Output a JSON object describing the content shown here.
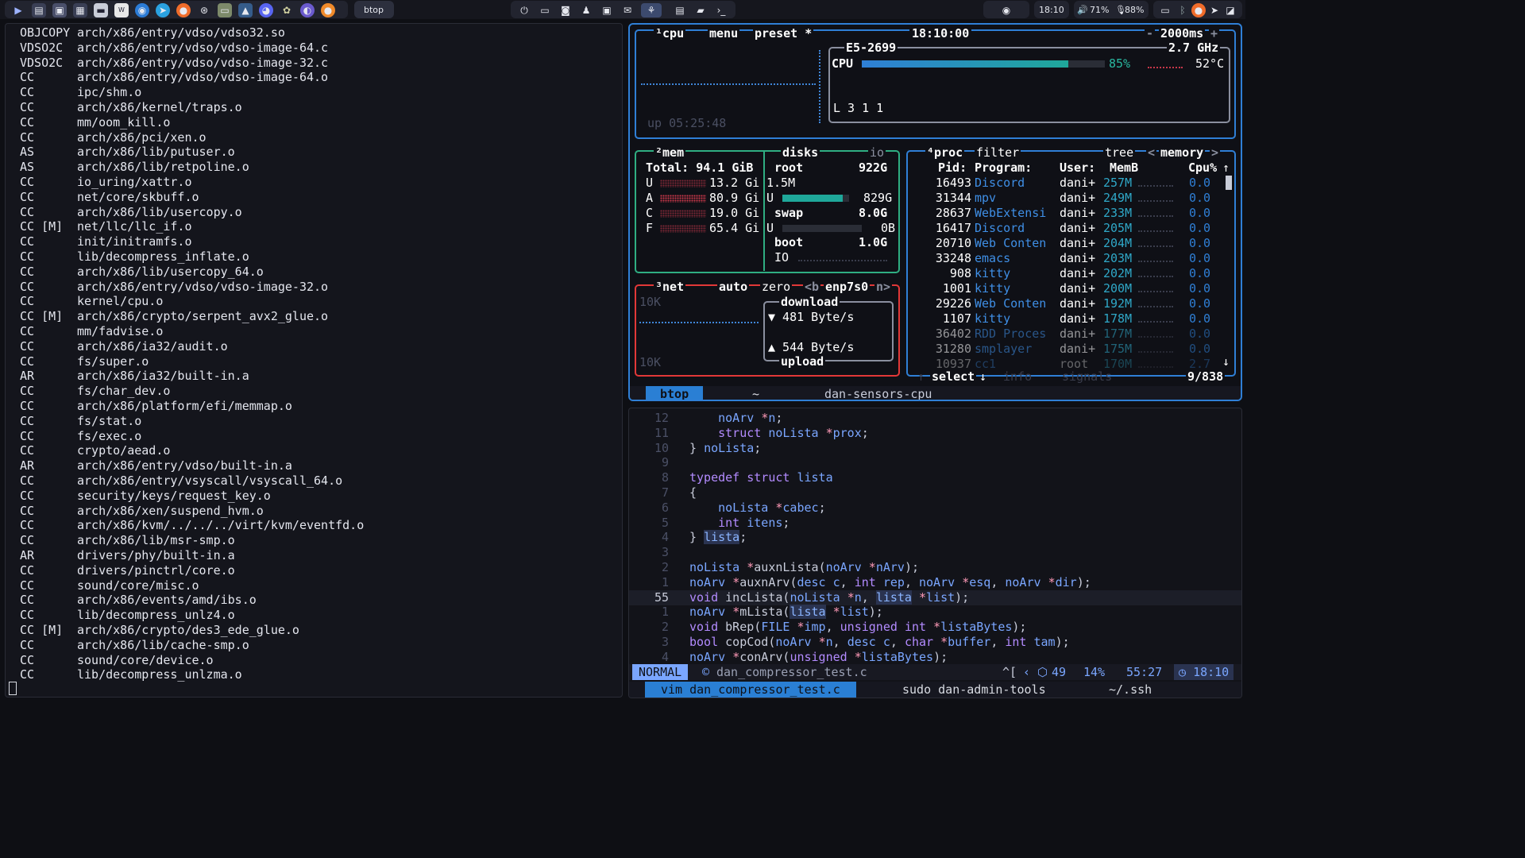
{
  "topbar": {
    "left_icons": [
      "launcher-icon",
      "folder-icon",
      "terminal-icon",
      "image-icon",
      "files-icon",
      "notes-icon",
      "browser-icon",
      "telegram-icon",
      "firefox-icon",
      "steam-icon",
      "archive-icon",
      "monitor-icon",
      "discord-icon",
      "game-icon",
      "apps-icon",
      "orange-icon"
    ],
    "active_window": "btop",
    "workspaces_icons": [
      "power-icon",
      "folder-icon",
      "discord-icon",
      "user-icon",
      "image-icon",
      "mail-icon",
      "code-icon",
      "grid-icon",
      "note-icon",
      "prompt-icon"
    ],
    "clock": "18:10",
    "volume": "71%",
    "mic": "88%",
    "tray_icons": [
      "eye-icon",
      "display-icon",
      "bluetooth-icon",
      "firefox-icon",
      "telegram-icon",
      "window-icon"
    ]
  },
  "build_log": [
    {
      "cmd": "OBJCOPY",
      "path": "arch/x86/entry/vdso/vdso32.so"
    },
    {
      "cmd": "VDSO2C",
      "path": "arch/x86/entry/vdso/vdso-image-64.c"
    },
    {
      "cmd": "VDSO2C",
      "path": "arch/x86/entry/vdso/vdso-image-32.c"
    },
    {
      "cmd": "CC",
      "path": "arch/x86/entry/vdso/vdso-image-64.o"
    },
    {
      "cmd": "CC",
      "path": "ipc/shm.o"
    },
    {
      "cmd": "CC",
      "path": "arch/x86/kernel/traps.o"
    },
    {
      "cmd": "CC",
      "path": "mm/oom_kill.o"
    },
    {
      "cmd": "CC",
      "path": "arch/x86/pci/xen.o"
    },
    {
      "cmd": "AS",
      "path": "arch/x86/lib/putuser.o"
    },
    {
      "cmd": "AS",
      "path": "arch/x86/lib/retpoline.o"
    },
    {
      "cmd": "CC",
      "path": "io_uring/xattr.o"
    },
    {
      "cmd": "CC",
      "path": "net/core/skbuff.o"
    },
    {
      "cmd": "CC",
      "path": "arch/x86/lib/usercopy.o"
    },
    {
      "cmd": "CC [M]",
      "path": "net/llc/llc_if.o"
    },
    {
      "cmd": "CC",
      "path": "init/initramfs.o"
    },
    {
      "cmd": "CC",
      "path": "lib/decompress_inflate.o"
    },
    {
      "cmd": "CC",
      "path": "arch/x86/lib/usercopy_64.o"
    },
    {
      "cmd": "CC",
      "path": "arch/x86/entry/vdso/vdso-image-32.o"
    },
    {
      "cmd": "CC",
      "path": "kernel/cpu.o"
    },
    {
      "cmd": "CC [M]",
      "path": "arch/x86/crypto/serpent_avx2_glue.o"
    },
    {
      "cmd": "CC",
      "path": "mm/fadvise.o"
    },
    {
      "cmd": "CC",
      "path": "arch/x86/ia32/audit.o"
    },
    {
      "cmd": "CC",
      "path": "fs/super.o"
    },
    {
      "cmd": "AR",
      "path": "arch/x86/ia32/built-in.a"
    },
    {
      "cmd": "CC",
      "path": "fs/char_dev.o"
    },
    {
      "cmd": "CC",
      "path": "arch/x86/platform/efi/memmap.o"
    },
    {
      "cmd": "CC",
      "path": "fs/stat.o"
    },
    {
      "cmd": "CC",
      "path": "fs/exec.o"
    },
    {
      "cmd": "CC",
      "path": "crypto/aead.o"
    },
    {
      "cmd": "AR",
      "path": "arch/x86/entry/vdso/built-in.a"
    },
    {
      "cmd": "CC",
      "path": "arch/x86/entry/vsyscall/vsyscall_64.o"
    },
    {
      "cmd": "CC",
      "path": "security/keys/request_key.o"
    },
    {
      "cmd": "CC",
      "path": "arch/x86/xen/suspend_hvm.o"
    },
    {
      "cmd": "CC",
      "path": "arch/x86/kvm/../../../virt/kvm/eventfd.o"
    },
    {
      "cmd": "CC",
      "path": "arch/x86/lib/msr-smp.o"
    },
    {
      "cmd": "AR",
      "path": "drivers/phy/built-in.a"
    },
    {
      "cmd": "CC",
      "path": "drivers/pinctrl/core.o"
    },
    {
      "cmd": "CC",
      "path": "sound/core/misc.o"
    },
    {
      "cmd": "CC",
      "path": "arch/x86/events/amd/ibs.o"
    },
    {
      "cmd": "CC",
      "path": "lib/decompress_unlz4.o"
    },
    {
      "cmd": "CC [M]",
      "path": "arch/x86/crypto/des3_ede_glue.o"
    },
    {
      "cmd": "CC",
      "path": "arch/x86/lib/cache-smp.o"
    },
    {
      "cmd": "CC",
      "path": "sound/core/device.o"
    },
    {
      "cmd": "CC",
      "path": "lib/decompress_unlzma.o"
    }
  ],
  "btop": {
    "header": {
      "cpu_tab": "cpu",
      "menu": "menu",
      "preset": "preset *",
      "time": "18:10:00",
      "minus": "-",
      "interval": "2000ms",
      "plus": "+"
    },
    "cpu": {
      "model": "E5-2699",
      "freq": "2.7 GHz",
      "label": "CPU",
      "usage": "85%",
      "usage_value": 0.85,
      "temp": "52°C",
      "load": "L 3 1 1",
      "uptime": "up 05:25:48"
    },
    "mem": {
      "title": "mem",
      "total": "Total: 94.1 GiB",
      "rows": [
        {
          "k": "U",
          "v": "13.2 Gi",
          "color": "#c8374a"
        },
        {
          "k": "A",
          "v": "80.9 Gi",
          "color": "#c8374a"
        },
        {
          "k": "C",
          "v": "19.0 Gi",
          "color": "#c8374a"
        },
        {
          "k": "F",
          "v": "65.4 Gi",
          "color": "#c8374a"
        }
      ]
    },
    "disks": {
      "title": "disks",
      "io_tab": "io",
      "root_label": "root",
      "root_size": "922G",
      "root_io": "1.5M",
      "root_used_k": "U",
      "root_used": "829G",
      "root_fill": 0.9,
      "swap_label": "swap",
      "swap_size": "8.0G",
      "swap_used_k": "U",
      "swap_used": "0B",
      "boot_label": "boot",
      "boot_size": "1.0G",
      "io_label": "IO"
    },
    "net": {
      "title": "net",
      "auto": "auto",
      "zero": "zero",
      "prev": "<b",
      "iface": "enp7s0",
      "next": "n>",
      "scale_top": "10K",
      "scale_bottom": "10K",
      "download_label": "download",
      "download": "▼ 481 Byte/s",
      "upload": "▲ 544 Byte/s",
      "upload_label": "upload"
    },
    "proc": {
      "title": "proc",
      "filter": "filter",
      "tree": "tree",
      "memory_prev": "<",
      "memory": "memory",
      "memory_next": ">",
      "headers": {
        "pid": "Pid:",
        "program": "Program:",
        "user": "User:",
        "mem": "MemB",
        "cpu": "Cpu%"
      },
      "rows": [
        {
          "pid": "16493",
          "program": "Discord",
          "user": "dani+",
          "mem": "257M",
          "cpu": "0.0"
        },
        {
          "pid": "31344",
          "program": "mpv",
          "user": "dani+",
          "mem": "249M",
          "cpu": "0.0"
        },
        {
          "pid": "28637",
          "program": "WebExtensi",
          "user": "dani+",
          "mem": "233M",
          "cpu": "0.0"
        },
        {
          "pid": "16417",
          "program": "Discord",
          "user": "dani+",
          "mem": "205M",
          "cpu": "0.0"
        },
        {
          "pid": "20710",
          "program": "Web Conten",
          "user": "dani+",
          "mem": "204M",
          "cpu": "0.0"
        },
        {
          "pid": "33248",
          "program": "emacs",
          "user": "dani+",
          "mem": "203M",
          "cpu": "0.0"
        },
        {
          "pid": "908",
          "program": "kitty",
          "user": "dani+",
          "mem": "202M",
          "cpu": "0.0"
        },
        {
          "pid": "1001",
          "program": "kitty",
          "user": "dani+",
          "mem": "200M",
          "cpu": "0.0"
        },
        {
          "pid": "29226",
          "program": "Web Conten",
          "user": "dani+",
          "mem": "192M",
          "cpu": "0.0"
        },
        {
          "pid": "1107",
          "program": "kitty",
          "user": "dani+",
          "mem": "178M",
          "cpu": "0.0"
        },
        {
          "pid": "36402",
          "program": "RDD Proces",
          "user": "dani+",
          "mem": "177M",
          "cpu": "0.0"
        },
        {
          "pid": "31280",
          "program": "smplayer",
          "user": "dani+",
          "mem": "175M",
          "cpu": "0.0"
        },
        {
          "pid": "10937",
          "program": "cc1",
          "user": "root",
          "mem": "170M",
          "cpu": "2.7"
        }
      ],
      "footer": {
        "select": "select",
        "info": "info",
        "signals": "signals",
        "count": "9/838"
      }
    }
  },
  "tmux_top": {
    "active": "btop",
    "sep": "~",
    "title": "dan-sensors-cpu"
  },
  "vim": {
    "lines": [
      {
        "n": "12",
        "html": "    <span class='t'>noArv</span> <span class='p'>*</span><span class='t'>n</span>;"
      },
      {
        "n": "11",
        "html": "    <span class='k'>struct</span> <span class='t'>noLista</span> <span class='p'>*</span><span class='t'>prox</span>;"
      },
      {
        "n": "10",
        "html": "} <span class='t'>noLista</span>;"
      },
      {
        "n": "9",
        "html": ""
      },
      {
        "n": "8",
        "html": "<span class='k'>typedef</span> <span class='k'>struct</span> <span class='t'>lista</span>"
      },
      {
        "n": "7",
        "html": "{"
      },
      {
        "n": "6",
        "html": "    <span class='t'>noLista</span> <span class='p'>*</span><span class='t'>cabec</span>;"
      },
      {
        "n": "5",
        "html": "    <span class='k'>int</span> <span class='t'>itens</span>;"
      },
      {
        "n": "4",
        "html": "} <span class='hl'>lista</span>;"
      },
      {
        "n": "3",
        "html": ""
      },
      {
        "n": "2",
        "html": "<span class='t'>noLista</span> <span class='p'>*</span><span class='f'>auxnLista</span>(<span class='t'>noArv</span> <span class='p'>*</span><span class='t'>nArv</span>);"
      },
      {
        "n": "1",
        "html": "<span class='t'>noArv</span> <span class='p'>*</span><span class='f'>auxnArv</span>(<span class='t'>desc</span> <span class='t'>c</span>, <span class='k'>int</span> <span class='t'>rep</span>, <span class='t'>noArv</span> <span class='p'>*</span><span class='t'>esq</span>, <span class='t'>noArv</span> <span class='p'>*</span><span class='t'>dir</span>);"
      },
      {
        "n": "55",
        "html": "<span class='k'>void</span> <span class='f'>incLista</span>(<span class='t'>noLista</span> <span class='p'>*</span><span class='t'>n</span>, <span class='hl'>lista</span> <span class='p'>*</span><span class='t'>list</span>);",
        "current": true
      },
      {
        "n": "1",
        "html": "<span class='t'>noArv</span> <span class='p'>*</span><span class='f'>mLista</span>(<span class='hl'>lista</span> <span class='p'>*</span><span class='t'>list</span>);"
      },
      {
        "n": "2",
        "html": "<span class='k'>void</span> <span class='f'>bRep</span>(<span class='t'>FILE</span> <span class='p'>*</span><span class='t'>imp</span>, <span class='k'>unsigned</span> <span class='k'>int</span> <span class='p'>*</span><span class='t'>listaBytes</span>);"
      },
      {
        "n": "3",
        "html": "<span class='k'>bool</span> <span class='f'>copCod</span>(<span class='t'>noArv</span> <span class='p'>*</span><span class='t'>n</span>, <span class='t'>desc</span> <span class='t'>c</span>, <span class='k'>char</span> <span class='p'>*</span><span class='t'>buffer</span>, <span class='k'>int</span> <span class='t'>tam</span>);"
      },
      {
        "n": "4",
        "html": "<span class='t'>noArv</span> <span class='p'>*</span><span class='f'>conArv</span>(<span class='k'>unsigned</span> <span class='p'>*</span><span class='t'>listaBytes</span>);"
      }
    ],
    "status": {
      "mode": "NORMAL",
      "file": "dan_compressor_test.c",
      "esc": "^[",
      "git": "49",
      "percent": "14%",
      "pos": "55:27",
      "clock": "18:10"
    }
  },
  "tmux_bottom": {
    "active": "vim dan_compressor_test.c",
    "win2": "sudo dan-admin-tools",
    "win3": "~/.ssh"
  }
}
